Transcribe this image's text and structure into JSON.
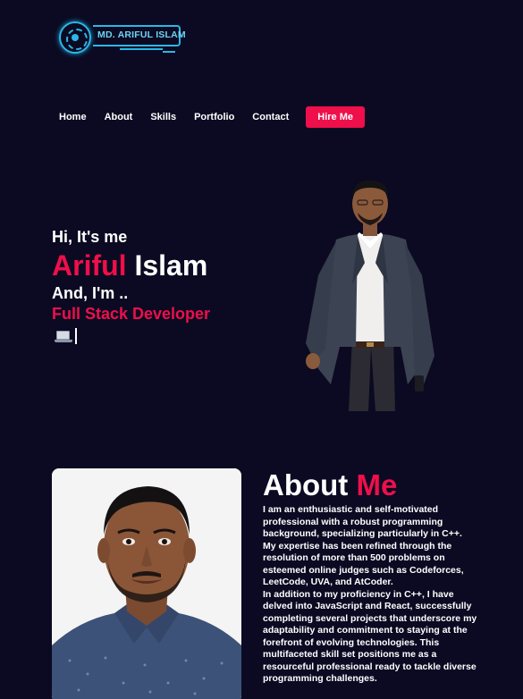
{
  "logo": {
    "text": "MD. ARIFUL ISLAM",
    "icon": "circuit-logo-icon",
    "color": "#2ab7e6"
  },
  "nav": {
    "items": [
      "Home",
      "About",
      "Skills",
      "Portfolio",
      "Contact"
    ],
    "cta": "Hire Me"
  },
  "hero": {
    "greeting": "Hi, It's me",
    "first_name": "Ariful",
    "last_name": " Islam",
    "and_text": "And, I'm ..",
    "role": "Full Stack Developer",
    "cursor_icon": "laptop-icon"
  },
  "about": {
    "title_main": "About ",
    "title_accent": "Me",
    "paragraph1": "I am an enthusiastic and self-motivated professional with a robust programming background, specializing particularly in C++. My expertise has been refined through the resolution of more than 500 problems on esteemed online judges such as Codeforces, LeetCode, UVA, and AtCoder.",
    "paragraph2": "In addition to my proficiency in C++, I have delved into JavaScript and React, successfully completing several projects that underscore my adaptability and commitment to staying at the forefront of evolving technologies. This multifaceted skill set positions me as a resourceful professional ready to tackle diverse programming challenges."
  },
  "colors": {
    "background": "#0b0a22",
    "accent": "#ee0f4b",
    "text": "#ffffff"
  }
}
